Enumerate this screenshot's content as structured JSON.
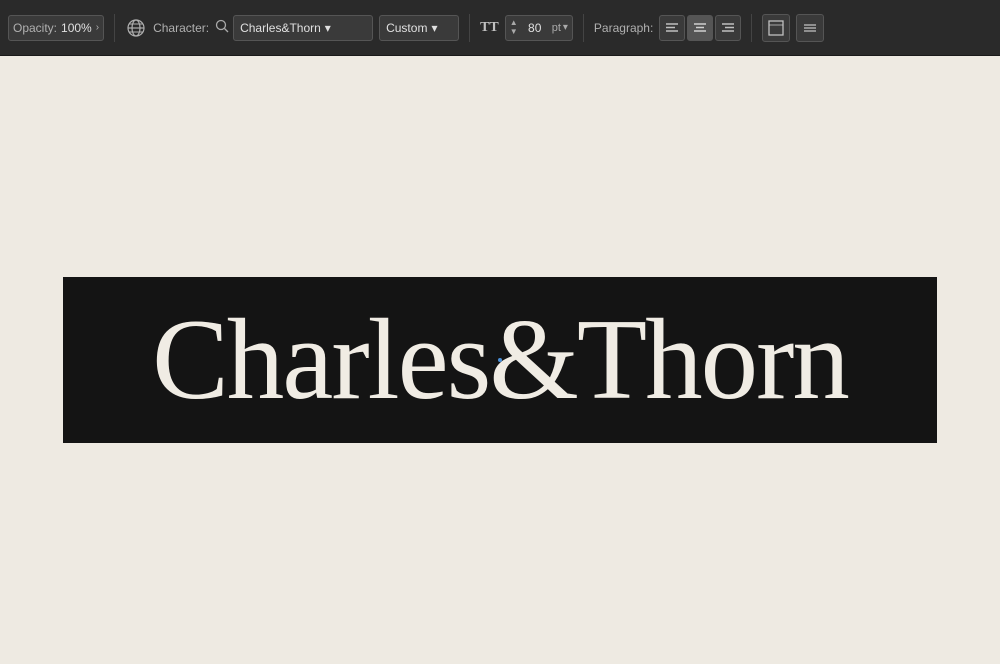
{
  "toolbar": {
    "opacity_label": "Opacity:",
    "opacity_value": "100%",
    "character_label": "Character:",
    "font_name": "Charles&Thorn",
    "style_value": "Custom",
    "size_value": "80",
    "size_unit": "pt",
    "paragraph_label": "Paragraph:",
    "align_left": "≡",
    "align_center": "≡",
    "align_right": "≡"
  },
  "canvas": {
    "banner_text": "Charles&Thorn",
    "background_color": "#141414",
    "text_color": "#f0ece4"
  },
  "icons": {
    "globe": "🌐",
    "search": "🔍",
    "font_size": "TT",
    "arrow_up": "▲",
    "arrow_down": "▼",
    "chevron_right": "›",
    "chevron_down": "▾",
    "align_left": "☰",
    "text_box": "⊡",
    "more": "≡"
  }
}
